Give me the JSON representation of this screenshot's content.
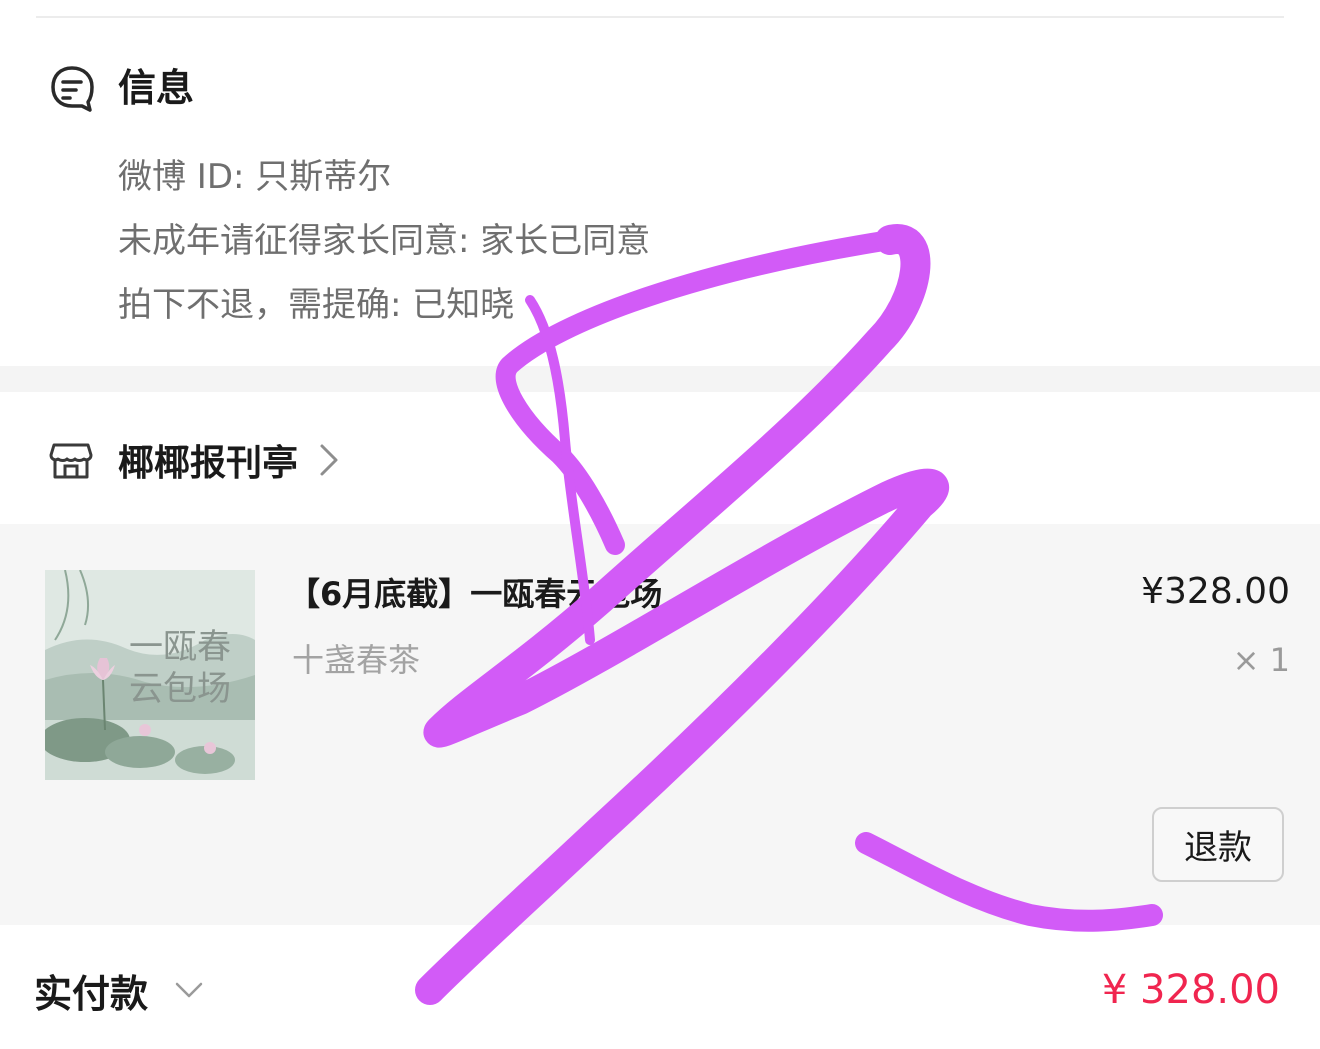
{
  "info": {
    "icon": "message-note-icon",
    "title": "信息",
    "lines": [
      "微博 ID: 只斯蒂尔",
      "未成年请征得家长同意: 家长已同意",
      "拍下不退，需提确: 已知晓"
    ]
  },
  "shop": {
    "icon": "store-icon",
    "name": "椰椰报刊亭"
  },
  "item": {
    "title": "【6月底截】一瓯春云包场",
    "subtitle": "十盏春茶",
    "price": "¥328.00",
    "quantity": "× 1",
    "thumbnail_text": "一瓯春\n云包场",
    "refund_label": "退款"
  },
  "total": {
    "label": "实付款",
    "amount": "¥ 328.00"
  },
  "colors": {
    "accent_price": "#f0254f",
    "scribble": "#d25bf7"
  }
}
